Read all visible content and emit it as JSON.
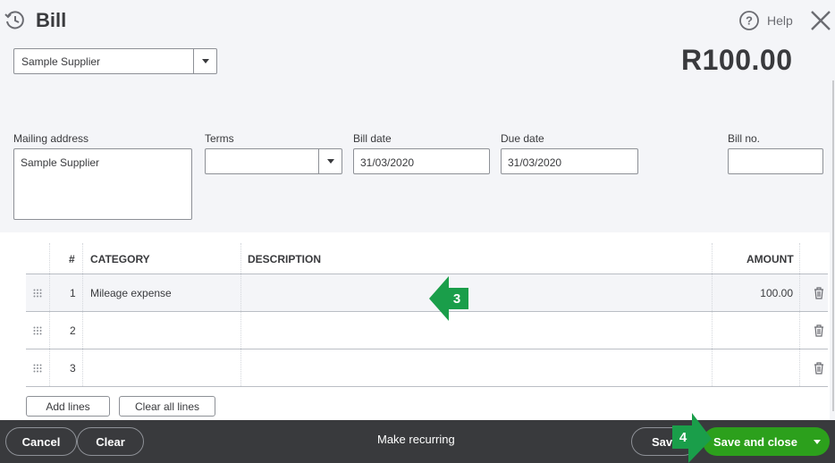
{
  "header": {
    "title": "Bill",
    "help_label": "Help",
    "supplier_value": "Sample Supplier",
    "total_amount": "R100.00"
  },
  "fields": {
    "mailing_label": "Mailing address",
    "mailing_value": "Sample Supplier",
    "terms_label": "Terms",
    "terms_value": "",
    "bill_date_label": "Bill date",
    "bill_date_value": "31/03/2020",
    "due_date_label": "Due date",
    "due_date_value": "31/03/2020",
    "bill_no_label": "Bill no.",
    "bill_no_value": ""
  },
  "table": {
    "headers": {
      "num": "#",
      "category": "CATEGORY",
      "description": "DESCRIPTION",
      "amount": "AMOUNT"
    },
    "rows": [
      {
        "num": "1",
        "category": "Mileage expense",
        "description": "",
        "amount": "100.00"
      },
      {
        "num": "2",
        "category": "",
        "description": "",
        "amount": ""
      },
      {
        "num": "3",
        "category": "",
        "description": "",
        "amount": ""
      }
    ],
    "add_lines_label": "Add lines",
    "clear_lines_label": "Clear all lines"
  },
  "callouts": {
    "step3": "3",
    "step4": "4",
    "color": "#1a9e4a"
  },
  "footer": {
    "cancel_label": "Cancel",
    "clear_label": "Clear",
    "make_recurring_label": "Make recurring",
    "save_label": "Save",
    "save_close_label": "Save and close",
    "save_close_color": "#2ca01c"
  }
}
